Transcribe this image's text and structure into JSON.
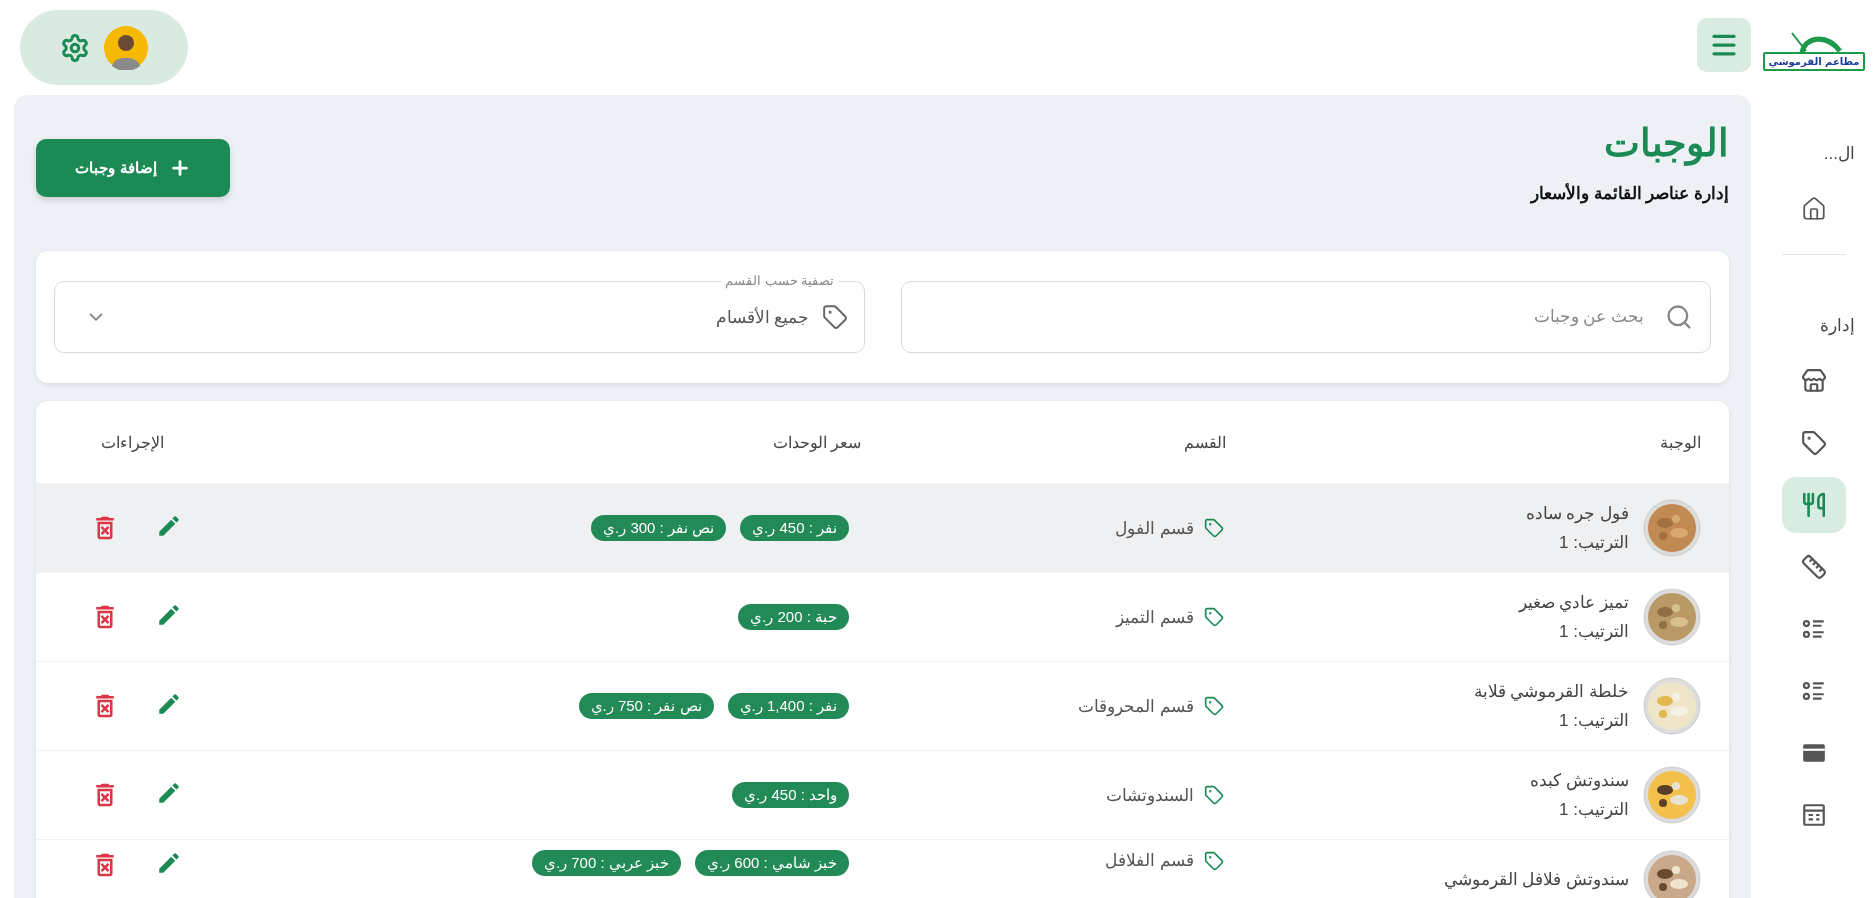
{
  "logo": {
    "text": "مطاعم القرموشي"
  },
  "sidebar": {
    "sections": [
      {
        "heading": "ال...",
        "items": [
          {
            "selected": false
          }
        ]
      },
      {
        "heading": "إدارة",
        "items": [
          {
            "selected": false
          },
          {
            "selected": false
          },
          {
            "selected": true
          },
          {
            "selected": false
          },
          {
            "selected": false
          },
          {
            "selected": false
          },
          {
            "selected": false
          },
          {
            "selected": false
          }
        ]
      }
    ]
  },
  "header": {
    "title": "الوجبات",
    "subtitle": "إدارة عناصر القائمة والأسعار",
    "add_button": "إضافة وجبات"
  },
  "filters": {
    "search": {
      "placeholder": "بحث عن وجبات"
    },
    "category": {
      "label": "تصفية حسب القسم",
      "value": "جميع الأقسام"
    }
  },
  "table": {
    "columns": [
      "الوجبة",
      "القسم",
      "سعر الوحدات",
      "الإجراءات"
    ],
    "rows": [
      {
        "name": "فول جره ساده",
        "order": "الترتيب: 1",
        "category": "قسم الفول",
        "prices": [
          "نفر : 450 ر.ي",
          "نص نفر : 300 ر.ي"
        ],
        "selected": true
      },
      {
        "name": "تميز عادي صغير",
        "order": "الترتيب: 1",
        "category": "قسم التميز",
        "prices": [
          "حبة : 200 ر.ي"
        ],
        "selected": false
      },
      {
        "name": "خلطة القرموشي قلابة",
        "order": "الترتيب: 1",
        "category": "قسم المحروقات",
        "prices": [
          "نفر : 1,400 ر.ي",
          "نص نفر : 750 ر.ي"
        ],
        "selected": false
      },
      {
        "name": "سندوتش كبده",
        "order": "الترتيب: 1",
        "category": "السندوتشات",
        "prices": [
          "واحد : 450 ر.ي"
        ],
        "selected": false
      },
      {
        "name": "سندوتش فلافل القرموشي",
        "category": "قسم الفلافل",
        "prices": [
          "خبز شامي : 600 ر.ي",
          "خبز عربي : 700 ر.ي"
        ],
        "selected": false
      }
    ]
  }
}
